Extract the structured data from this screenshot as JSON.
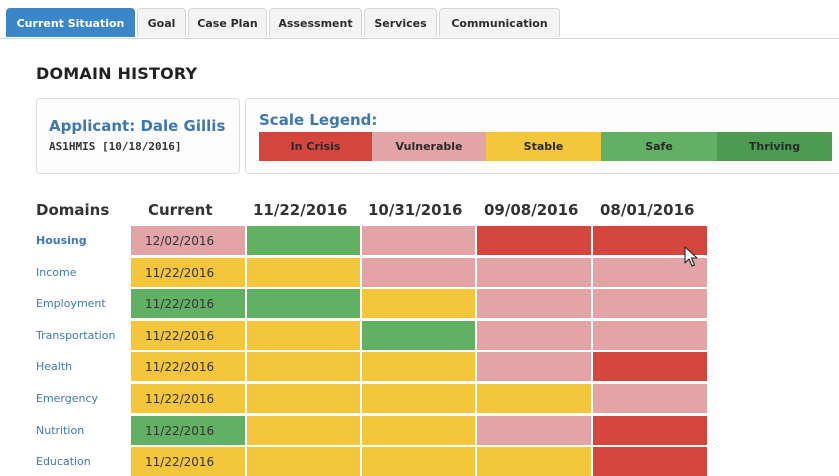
{
  "colors": {
    "In Crisis": "#d2463e",
    "Vulnerable": "#e3a4a7",
    "Stable": "#f3c63c",
    "Safe": "#62b063",
    "Thriving": "#4d9a52"
  },
  "tabs": [
    {
      "label": "Current Situation",
      "active": true
    },
    {
      "label": "Goal",
      "active": false
    },
    {
      "label": "Case Plan",
      "active": false
    },
    {
      "label": "Assessment",
      "active": false
    },
    {
      "label": "Services",
      "active": false
    },
    {
      "label": "Communication",
      "active": false
    }
  ],
  "page": {
    "title": "DOMAIN HISTORY",
    "applicant_name": "Applicant: Dale Gillis",
    "applicant_id": "AS1HMIS [10/18/2016]"
  },
  "legend": {
    "title": "Scale Legend:",
    "items": [
      "In Crisis",
      "Vulnerable",
      "Stable",
      "Safe",
      "Thriving"
    ]
  },
  "grid": {
    "headers": {
      "domains": "Domains",
      "current": "Current",
      "history": [
        "11/22/2016",
        "10/31/2016",
        "09/08/2016",
        "08/01/2016"
      ]
    },
    "rows": [
      {
        "domain": "Housing",
        "current_date": "12/02/2016",
        "current": "Vulnerable",
        "history": [
          "Safe",
          "Vulnerable",
          "In Crisis",
          "In Crisis"
        ]
      },
      {
        "domain": "Income",
        "current_date": "11/22/2016",
        "current": "Stable",
        "history": [
          "Stable",
          "Vulnerable",
          "Vulnerable",
          "Vulnerable"
        ]
      },
      {
        "domain": "Employment",
        "current_date": "11/22/2016",
        "current": "Safe",
        "history": [
          "Safe",
          "Stable",
          "Vulnerable",
          "Vulnerable"
        ]
      },
      {
        "domain": "Transportation",
        "current_date": "11/22/2016",
        "current": "Stable",
        "history": [
          "Stable",
          "Safe",
          "Vulnerable",
          "Vulnerable"
        ]
      },
      {
        "domain": "Health",
        "current_date": "11/22/2016",
        "current": "Stable",
        "history": [
          "Stable",
          "Stable",
          "Vulnerable",
          "In Crisis"
        ]
      },
      {
        "domain": "Emergency",
        "current_date": "11/22/2016",
        "current": "Stable",
        "history": [
          "Stable",
          "Stable",
          "Stable",
          "Vulnerable"
        ]
      },
      {
        "domain": "Nutrition",
        "current_date": "11/22/2016",
        "current": "Safe",
        "history": [
          "Stable",
          "Stable",
          "Vulnerable",
          "In Crisis"
        ]
      },
      {
        "domain": "Education",
        "current_date": "11/22/2016",
        "current": "Stable",
        "history": [
          "Stable",
          "Stable",
          "Stable",
          "In Crisis"
        ]
      }
    ]
  }
}
